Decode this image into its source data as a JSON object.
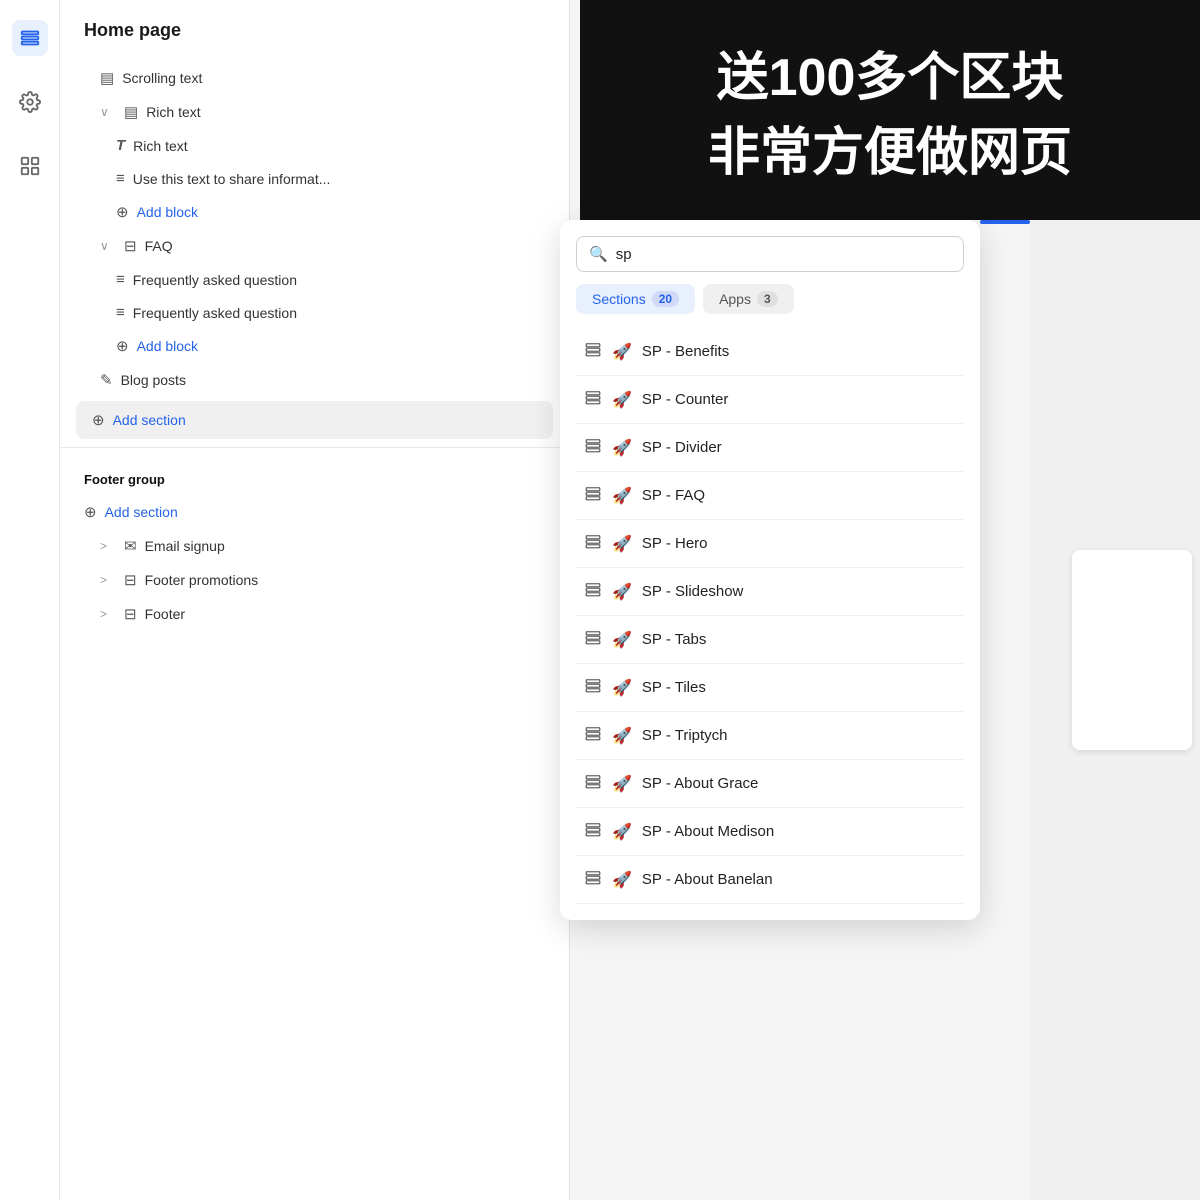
{
  "banner": {
    "line1": "送100多个区块",
    "line2": "非常方便做网页"
  },
  "sidebar": {
    "icons": [
      {
        "name": "layers-icon",
        "symbol": "⊟",
        "active": true
      },
      {
        "name": "settings-icon",
        "symbol": "⚙",
        "active": false
      },
      {
        "name": "apps-icon",
        "symbol": "⊞",
        "active": false
      }
    ]
  },
  "panel": {
    "header": "Home page",
    "tree": [
      {
        "id": "scrolling-text",
        "indent": "indent1",
        "icon": "▤",
        "label": "Scrolling text",
        "hasChevron": false
      },
      {
        "id": "rich-text-parent",
        "indent": "indent1",
        "icon": "▤",
        "label": "Rich text",
        "hasChevron": true,
        "expanded": true
      },
      {
        "id": "rich-text-child",
        "indent": "indent2",
        "icon": "T",
        "label": "Rich text",
        "hasChevron": false
      },
      {
        "id": "use-this-text",
        "indent": "indent2",
        "icon": "≡",
        "label": "Use this text to share informat...",
        "hasChevron": false
      },
      {
        "id": "add-block-1",
        "indent": "indent2",
        "icon": "⊕",
        "label": "Add block",
        "isAdd": true
      },
      {
        "id": "faq-parent",
        "indent": "indent1",
        "icon": "⊟",
        "label": "FAQ",
        "hasChevron": true,
        "expanded": true
      },
      {
        "id": "faq-q1",
        "indent": "indent2",
        "icon": "≡",
        "label": "Frequently asked question",
        "hasChevron": false
      },
      {
        "id": "faq-q2",
        "indent": "indent2",
        "icon": "≡",
        "label": "Frequently asked question",
        "hasChevron": false
      },
      {
        "id": "add-block-2",
        "indent": "indent2",
        "icon": "⊕",
        "label": "Add block",
        "isAdd": true
      },
      {
        "id": "blog-posts",
        "indent": "indent1",
        "icon": "✎",
        "label": "Blog posts",
        "hasChevron": false
      },
      {
        "id": "add-section-1",
        "indent": "",
        "icon": "⊕",
        "label": "Add section",
        "isAddSection": true
      }
    ],
    "footer_group": "Footer group",
    "footer_tree": [
      {
        "id": "add-section-2",
        "icon": "⊕",
        "label": "Add section",
        "isAdd": true
      },
      {
        "id": "email-signup",
        "indent": "indent1",
        "icon": "✉",
        "label": "Email signup",
        "hasChevron": true
      },
      {
        "id": "footer-promo",
        "indent": "indent1",
        "icon": "⊟",
        "label": "Footer promotions",
        "hasChevron": true
      },
      {
        "id": "footer",
        "indent": "indent1",
        "icon": "⊟",
        "label": "Footer",
        "hasChevron": true
      }
    ]
  },
  "search_popup": {
    "search_value": "sp",
    "search_placeholder": "Search",
    "tab_sections_label": "Sections",
    "tab_sections_count": "20",
    "tab_apps_label": "Apps",
    "tab_apps_count": "3",
    "results": [
      {
        "id": "sp-benefits",
        "label": "SP - Benefits"
      },
      {
        "id": "sp-counter",
        "label": "SP - Counter"
      },
      {
        "id": "sp-divider",
        "label": "SP - Divider"
      },
      {
        "id": "sp-faq",
        "label": "SP - FAQ"
      },
      {
        "id": "sp-hero",
        "label": "SP - Hero"
      },
      {
        "id": "sp-slideshow",
        "label": "SP - Slideshow"
      },
      {
        "id": "sp-tabs",
        "label": "SP - Tabs"
      },
      {
        "id": "sp-tiles",
        "label": "SP - Tiles"
      },
      {
        "id": "sp-triptych",
        "label": "SP - Triptych"
      },
      {
        "id": "sp-about-grace",
        "label": "SP - About Grace"
      },
      {
        "id": "sp-about-medison",
        "label": "SP - About Medison"
      },
      {
        "id": "sp-about-banalan",
        "label": "SP - About Banelan"
      }
    ]
  }
}
